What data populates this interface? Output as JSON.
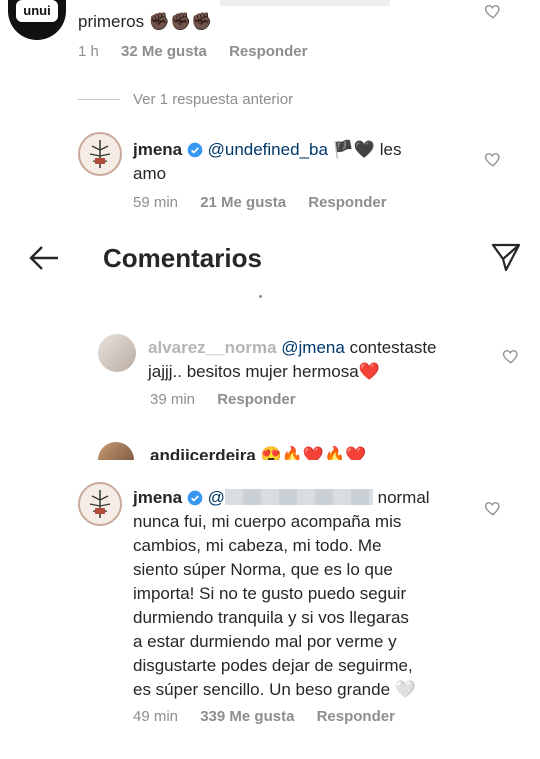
{
  "top_comment": {
    "text": "primeros",
    "emojis": "✊🏿✊🏿✊🏿",
    "time": "1 h",
    "likes": "32 Me gusta",
    "reply": "Responder",
    "avatar_text": "unui"
  },
  "view_replies": "Ver 1 respuesta anterior",
  "reply1": {
    "user": "jmena",
    "mention": "@undefined_ba",
    "emojis": "🏴🖤",
    "text_rest": "les",
    "text_line2": "amo",
    "time": "59 min",
    "likes": "21 Me gusta",
    "reply": "Responder"
  },
  "header": {
    "title": "Comentarios"
  },
  "comment2": {
    "user": "alvarez__norma",
    "mention": "@jmena",
    "text_rest": "contestaste",
    "text_line2": "jajjj.. besitos mujer hermosa",
    "emoji": "❤️",
    "time": "39 min",
    "reply": "Responder"
  },
  "comment3": {
    "user": "andiicerdeira",
    "emojis": "😍🔥❤️🔥❤️"
  },
  "reply2": {
    "user": "jmena",
    "mention": "@",
    "line1_rest": "normal",
    "lines": [
      "nunca fui, mi cuerpo acompaña mis",
      "cambios, mi cabeza, mi todo. Me",
      "siento súper Norma, que es lo que",
      "importa! Si no te gusto puedo seguir",
      "durmiendo tranquila y si vos llegaras",
      "a estar durmiendo mal por verme y",
      "disgustarte podes dejar de seguirme,",
      "es súper sencillo. Un beso grande 🤍"
    ],
    "time": "49 min",
    "likes": "339 Me gusta",
    "reply": "Responder"
  }
}
